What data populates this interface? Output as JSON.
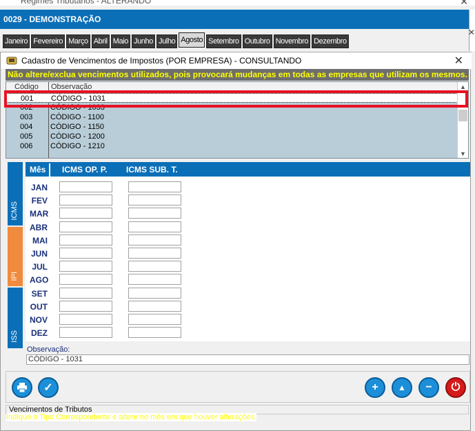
{
  "background_window": {
    "title": "Regimes Tributários - ALTERANDO",
    "header": "0029 - DEMONSTRAÇÃO",
    "months": [
      "Janeiro",
      "Fevereiro",
      "Março",
      "Abril",
      "Maio",
      "Junho",
      "Julho",
      "Agosto",
      "Setembro",
      "Outubro",
      "Novembro",
      "Dezembro"
    ],
    "active_month": "Agosto"
  },
  "dialog": {
    "title": "Cadastro de Vencimentos de Impostos  (POR EMPRESA)   -   CONSULTANDO",
    "warning": "Não altere/exclua vencimentos utilizados, pois provocará mudanças em todas as empresas que utilizam os mesmos.",
    "grid": {
      "columns": [
        "Código",
        "Observação"
      ],
      "rows": [
        {
          "code": "001",
          "obs": "CÓDIGO - 1031"
        },
        {
          "code": "002",
          "obs": "CÓDIGO - 1033"
        },
        {
          "code": "003",
          "obs": "CÓDIGO - 1100"
        },
        {
          "code": "004",
          "obs": "CÓDIGO - 1150"
        },
        {
          "code": "005",
          "obs": "CÓDIGO - 1200"
        },
        {
          "code": "006",
          "obs": "CÓDIGO - 1210"
        }
      ]
    },
    "tabs": [
      "ICMS",
      "IPI",
      "ISS"
    ],
    "month_table": {
      "headers": [
        "Mês",
        "ICMS OP. P.",
        "ICMS SUB. T."
      ],
      "months": [
        "JAN",
        "FEV",
        "MAR",
        "ABR",
        "MAI",
        "JUN",
        "JUL",
        "AGO",
        "SET",
        "OUT",
        "NOV",
        "DEZ"
      ]
    },
    "observacao_label": "Observação:",
    "observacao_value": "CÓDIGO - 1031",
    "status": "Vencimentos de Tributos",
    "hint": "Indique o Tipo Correspondente e altere no mês em que houver alterações."
  },
  "colors": {
    "accent": "#0b6fb8",
    "warning_text": "#ffff00",
    "highlight": "#e81123",
    "ipi_tab": "#f08a3c"
  }
}
